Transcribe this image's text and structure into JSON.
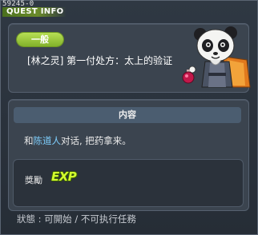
{
  "header": {
    "quest_id": "59245-0",
    "title": "QUEST INFO"
  },
  "quest": {
    "category": "一般",
    "name": "[林之灵] 第一付处方：太上的验证",
    "npc_icon": "panda-npc-holding-potion"
  },
  "content": {
    "header": "内容",
    "desc_prefix": "和",
    "desc_npc": "陈道人",
    "desc_suffix": "对话, 把药拿来。",
    "npc_name_color": "#7fd0ff"
  },
  "reward": {
    "label": "獎勵",
    "exp_label": "EXP"
  },
  "status": {
    "text": "狀態 :  可開始 / 不可执行任務"
  },
  "colors": {
    "category_badge": "#9acb3c",
    "exp_text": "#d2ff2e"
  }
}
